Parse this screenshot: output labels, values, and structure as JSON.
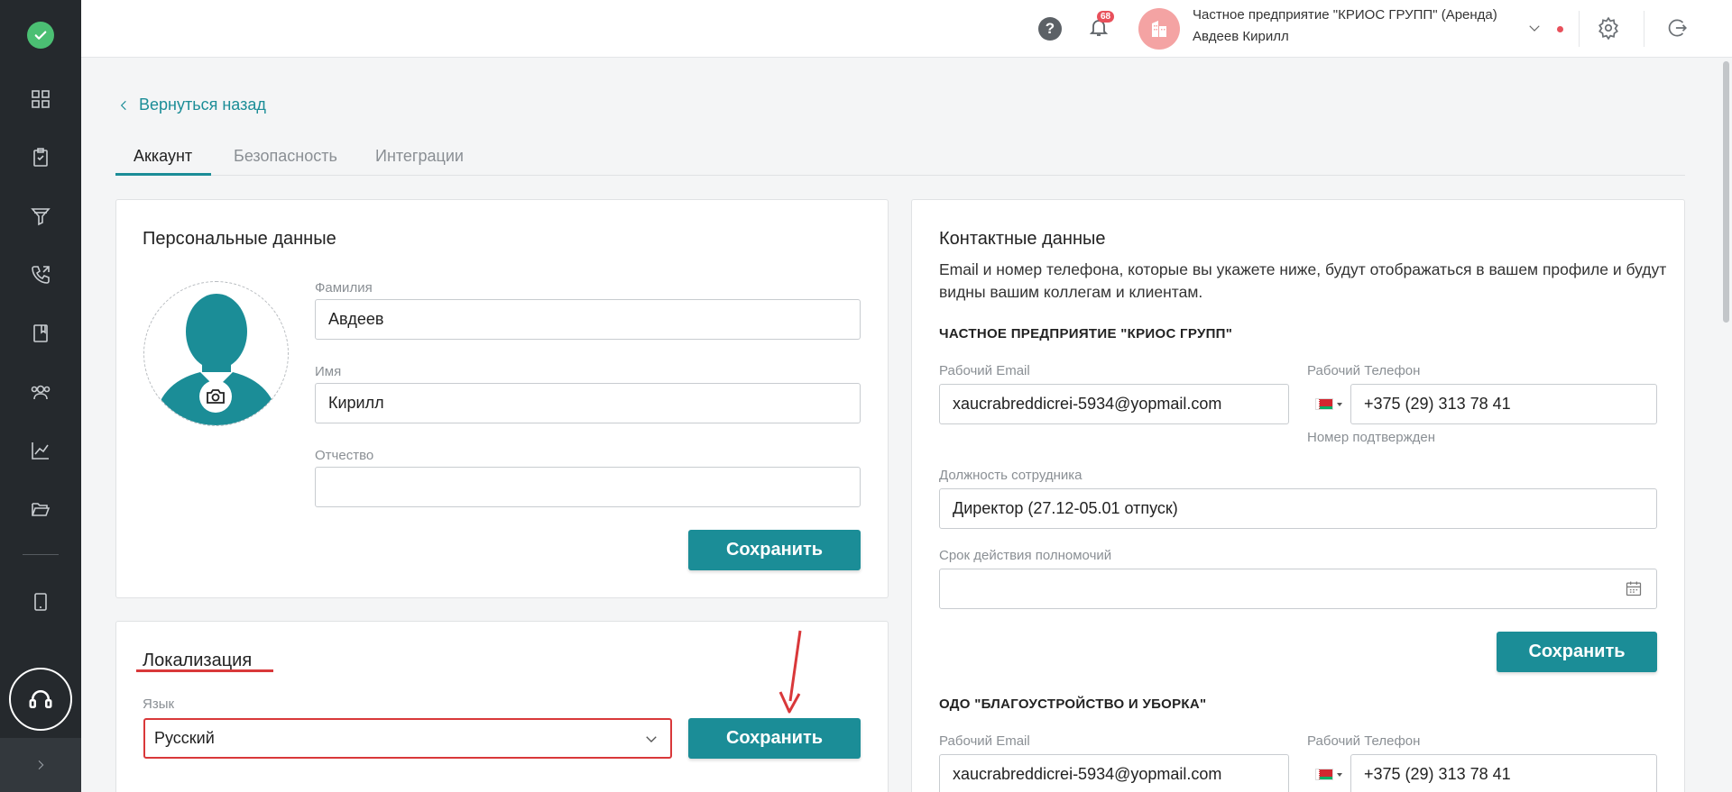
{
  "header": {
    "help_label": "?",
    "notifications_count": "68",
    "company_name": "Частное предприятие \"КРИОС ГРУПП\" (Аренда)",
    "user_name": "Авдеев Кирилл"
  },
  "sidebar": {
    "items": [
      "dashboard-icon",
      "documents-icon",
      "funnel-icon",
      "calls-icon",
      "book-icon",
      "team-icon",
      "chart-icon",
      "folder-icon",
      "tablet-icon"
    ]
  },
  "nav": {
    "back_label": "Вернуться назад",
    "tabs": [
      {
        "label": "Аккаунт",
        "active": true
      },
      {
        "label": "Безопасность",
        "active": false
      },
      {
        "label": "Интеграции",
        "active": false
      }
    ]
  },
  "personal": {
    "title": "Персональные данные",
    "last_name_label": "Фамилия",
    "last_name_value": "Авдеев",
    "first_name_label": "Имя",
    "first_name_value": "Кирилл",
    "patronymic_label": "Отчество",
    "patronymic_value": "",
    "save_label": "Сохранить"
  },
  "localization": {
    "title": "Локализация",
    "language_label": "Язык",
    "language_value": "Русский",
    "save_label": "Сохранить"
  },
  "contacts": {
    "title": "Контактные данные",
    "description": "Email и номер телефона, которые вы укажете ниже, будут отображаться в вашем профиле и будут видны вашим коллегам и клиентам.",
    "save_label": "Сохранить",
    "orgs": [
      {
        "name": "ЧАСТНОЕ ПРЕДПРИЯТИЕ \"КРИОС ГРУПП\"",
        "email_label": "Рабочий Email",
        "email_value": "xaucrabreddicrei-5934@yopmail.com",
        "phone_label": "Рабочий Телефон",
        "phone_value": "+375 (29) 313 78 41",
        "phone_status": "Номер подтвержден",
        "position_label": "Должность сотрудника",
        "position_value": "Директор (27.12-05.01 отпуск)",
        "authority_label": "Срок действия полномочий",
        "authority_value": ""
      },
      {
        "name": "ОДО \"БЛАГОУСТРОЙСТВО И УБОРКА\"",
        "email_label": "Рабочий Email",
        "email_value": "xaucrabreddicrei-5934@yopmail.com",
        "phone_label": "Рабочий Телефон",
        "phone_value": "+375 (29) 313 78 41"
      }
    ]
  },
  "colors": {
    "accent": "#1b8d97",
    "sidebar_bg": "#25292d",
    "alert": "#d9383a"
  }
}
